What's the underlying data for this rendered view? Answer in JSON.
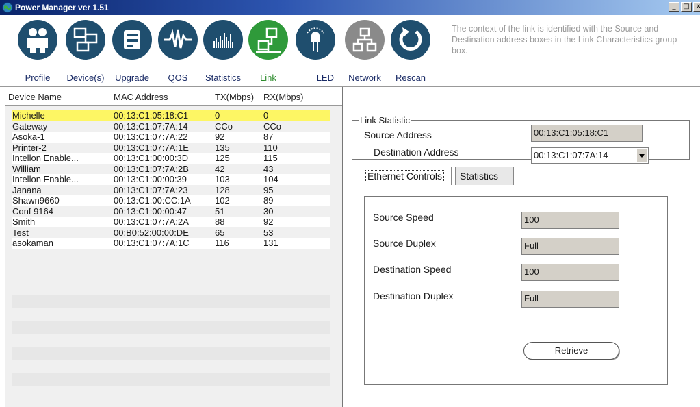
{
  "window": {
    "title": "Power Manager ver 1.51",
    "controls": [
      "minimize",
      "maximize"
    ]
  },
  "toolbar": {
    "items": [
      {
        "label": "Profile",
        "icon": "users-icon"
      },
      {
        "label": "Device(s)",
        "icon": "computers-icon"
      },
      {
        "label": "Upgrade",
        "icon": "upgrade-icon"
      },
      {
        "label": "QOS",
        "icon": "waveform-icon"
      },
      {
        "label": "Statistics",
        "icon": "bar-chart-icon"
      },
      {
        "label": "Link",
        "icon": "network-link-icon"
      },
      {
        "label": "LED",
        "icon": "led-bulb-icon"
      },
      {
        "label": "Network",
        "icon": "network-tree-icon"
      },
      {
        "label": "Rescan",
        "icon": "refresh-icon"
      }
    ],
    "active": "Link",
    "hint": "The context of the link is identified with the Source and Destination address boxes in the Link Characteristics group box."
  },
  "device_list": {
    "columns": [
      "Device Name",
      "MAC Address",
      "TX(Mbps)",
      "RX(Mbps)"
    ],
    "rows": [
      {
        "name": "Michelle",
        "mac": "00:13:C1:05:18:C1",
        "tx": "0",
        "rx": "0"
      },
      {
        "name": "Gateway",
        "mac": "00:13:C1:07:7A:14",
        "tx": "CCo",
        "rx": "CCo"
      },
      {
        "name": "Asoka-1",
        "mac": "00:13:C1:07:7A:22",
        "tx": "92",
        "rx": "87"
      },
      {
        "name": "Printer-2",
        "mac": "00:13:C1:07:7A:1E",
        "tx": "135",
        "rx": "110"
      },
      {
        "name": "Intellon Enable...",
        "mac": "00:13:C1:00:00:3D",
        "tx": "125",
        "rx": "115"
      },
      {
        "name": "William",
        "mac": "00:13:C1:07:7A:2B",
        "tx": "42",
        "rx": "43"
      },
      {
        "name": "Intellon Enable...",
        "mac": "00:13:C1:00:00:39",
        "tx": "103",
        "rx": "104"
      },
      {
        "name": "Janana",
        "mac": "00:13:C1:07:7A:23",
        "tx": "128",
        "rx": "95"
      },
      {
        "name": "Shawn9660",
        "mac": "00:13:C1:00:CC:1A",
        "tx": "102",
        "rx": "89"
      },
      {
        "name": "Conf 9164",
        "mac": "00:13:C1:00:00:47",
        "tx": "51",
        "rx": "30"
      },
      {
        "name": "Smith",
        "mac": "00:13:C1:07:7A:2A",
        "tx": "88",
        "rx": "92"
      },
      {
        "name": "Test",
        "mac": "00:B0:52:00:00:DE",
        "tx": "65",
        "rx": "53"
      },
      {
        "name": "asokaman",
        "mac": "00:13:C1:07:7A:1C",
        "tx": "116",
        "rx": "131"
      }
    ],
    "selected_index": 0
  },
  "link_statistic": {
    "group_title": "Link Statistic",
    "source_label": "Source Address",
    "source_value": "00:13:C1:05:18:C1",
    "destination_label": "Destination Address",
    "destination_value": "00:13:C1:07:7A:14"
  },
  "tabs": [
    {
      "label": "Ethernet Controls",
      "active": true
    },
    {
      "label": "Statistics",
      "active": false
    }
  ],
  "ethernet_controls": {
    "fields": [
      {
        "label": "Source Speed",
        "value": "100"
      },
      {
        "label": "Source Duplex",
        "value": "Full"
      },
      {
        "label": "Destination Speed",
        "value": "100"
      },
      {
        "label": "Destination Duplex",
        "value": "Full"
      }
    ],
    "retrieve_label": "Retrieve"
  },
  "colors": {
    "selected_row": "#fdf664",
    "toolbar_icon_dark": "#1f4e6e",
    "toolbar_icon_active": "#2f9a3a",
    "toolbar_icon_gray": "#8a8a8a"
  }
}
